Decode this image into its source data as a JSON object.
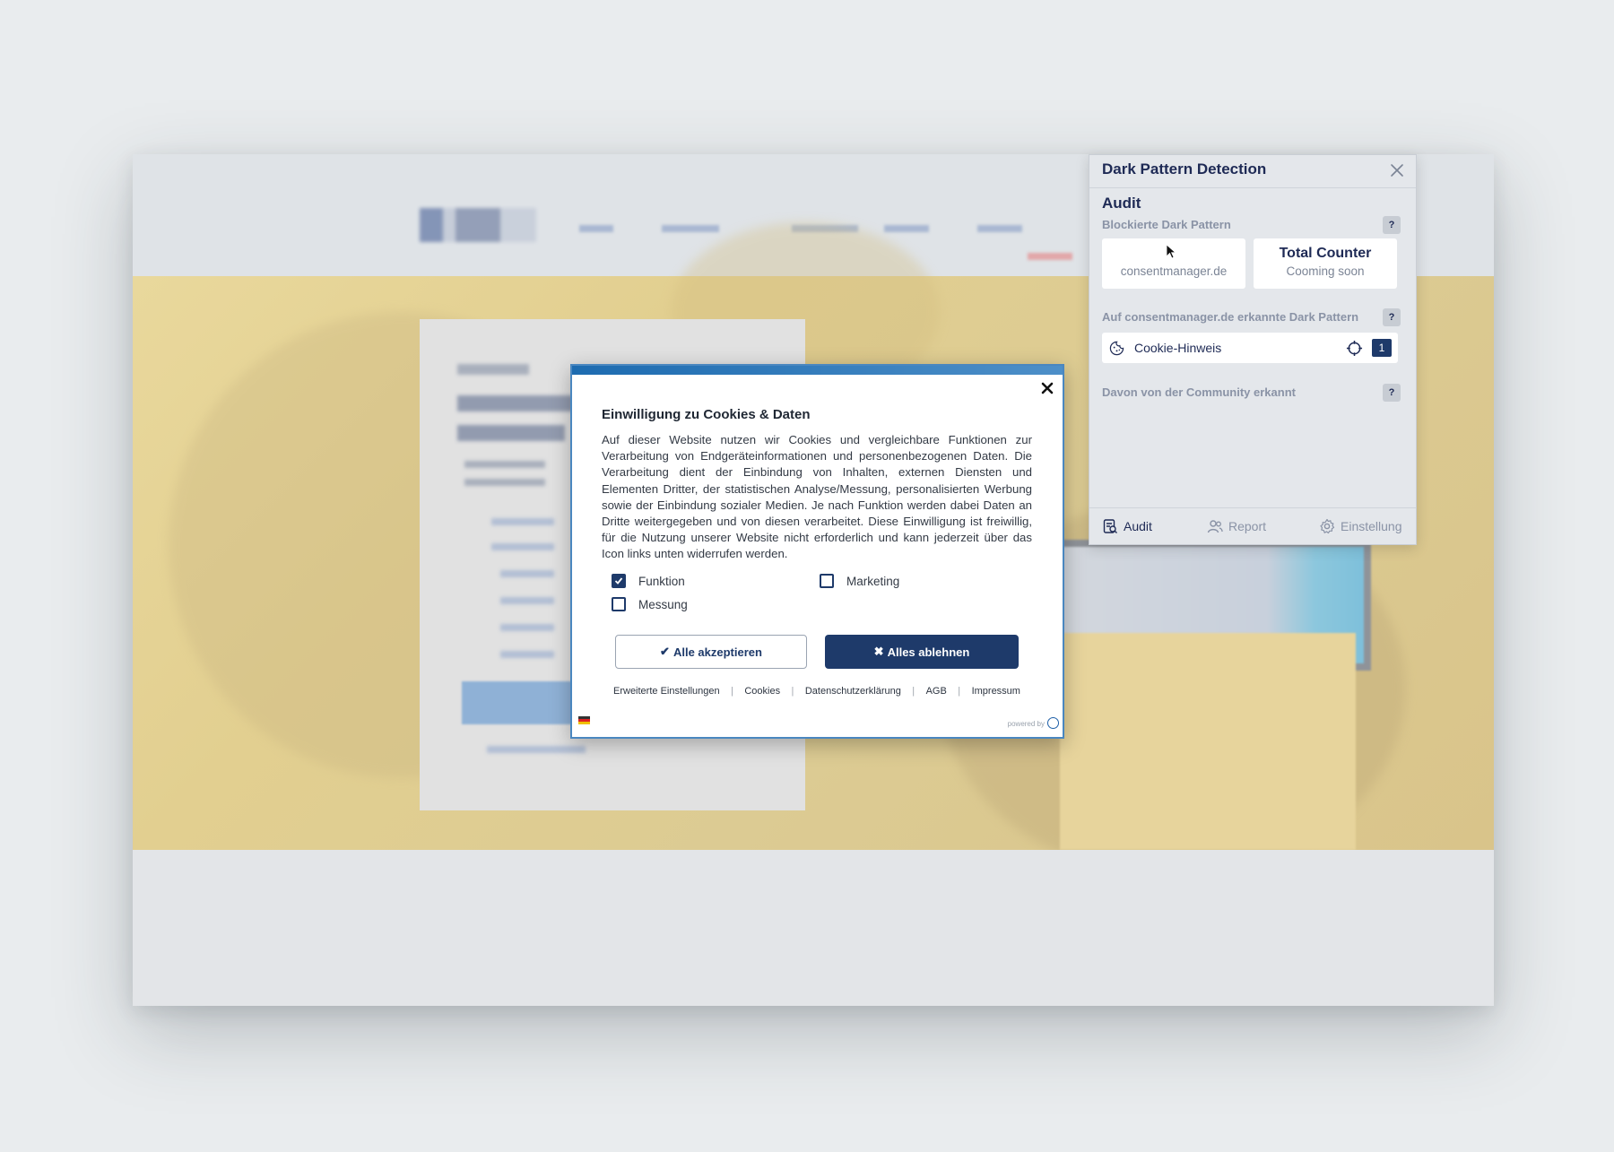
{
  "cookie_dialog": {
    "title": "Einwilligung zu Cookies & Daten",
    "body": "Auf dieser Website nutzen wir Cookies und vergleichbare Funktionen zur Verarbeitung von Endgeräteinformationen und personenbezogenen Daten. Die Verarbeitung dient der Einbindung von Inhalten, externen Diensten und Elementen Dritter, der statistischen Analyse/Messung, personalisierten Werbung sowie der Einbindung sozialer Medien. Je nach Funktion werden dabei Daten an Dritte weitergegeben und von diesen verarbeitet. Diese Einwilligung ist freiwillig, für die Nutzung unserer Website nicht erforderlich und kann jederzeit über das Icon links unten widerrufen werden.",
    "checkboxes": [
      {
        "label": "Funktion",
        "checked": true
      },
      {
        "label": "Marketing",
        "checked": false
      },
      {
        "label": "Messung",
        "checked": false
      }
    ],
    "accept_label": "Alle akzeptieren",
    "reject_label": "Alles ablehnen",
    "links": [
      "Erweiterte Einstellungen",
      "Cookies",
      "Datenschutzerklärung",
      "AGB",
      "Impressum"
    ],
    "separator": "|",
    "powered_by": "powered by",
    "close_glyph": "✕",
    "accept_glyph": "✔",
    "reject_glyph": "✖"
  },
  "extension": {
    "title": "Dark Pattern Detection",
    "close_glyph": "✕",
    "section_title": "Audit",
    "blocked_label": "Blockierte Dark Pattern",
    "help_glyph": "?",
    "cards": [
      {
        "big": "",
        "small": "consentmanager.de"
      },
      {
        "big": "Total Counter",
        "small": "Cooming soon"
      }
    ],
    "detected_label": "Auf consentmanager.de erkannte Dark Pattern",
    "patterns": [
      {
        "label": "Cookie-Hinweis",
        "count": "1",
        "icon": "cookie-icon"
      }
    ],
    "community_label": "Davon von der Community erkannt",
    "footer_tabs": [
      {
        "label": "Audit",
        "icon": "audit-icon",
        "active": true
      },
      {
        "label": "Report",
        "icon": "users-icon",
        "active": false
      },
      {
        "label": "Einstellung",
        "icon": "gear-icon",
        "active": false
      }
    ]
  },
  "colors": {
    "primary_navy": "#1e3a6a",
    "panel_title": "#1e2a55",
    "muted_label": "#8a93a6",
    "hero_yellow": "#e2cf90"
  }
}
